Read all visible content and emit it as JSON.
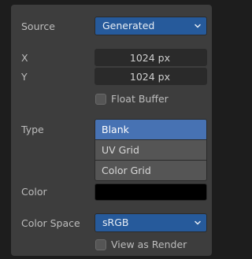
{
  "source": {
    "label": "Source",
    "value": "Generated",
    "chevron_icon": "chevron-down-icon"
  },
  "size": {
    "x_label": "X",
    "x_value": "1024 px",
    "y_label": "Y",
    "y_value": "1024 px"
  },
  "float_buffer": {
    "label": "Float Buffer",
    "checked": false
  },
  "type": {
    "label": "Type",
    "options": [
      {
        "label": "Blank",
        "selected": true
      },
      {
        "label": "UV Grid",
        "selected": false
      },
      {
        "label": "Color Grid",
        "selected": false
      }
    ]
  },
  "color": {
    "label": "Color",
    "value": "#000000"
  },
  "color_space": {
    "label": "Color Space",
    "value": "sRGB",
    "chevron_icon": "chevron-down-icon"
  },
  "view_as_render": {
    "label": "View as Render",
    "checked": false
  },
  "colors": {
    "accent": "#4772b3",
    "dropdown": "#265a9b",
    "panel": "#3d3d3d"
  }
}
